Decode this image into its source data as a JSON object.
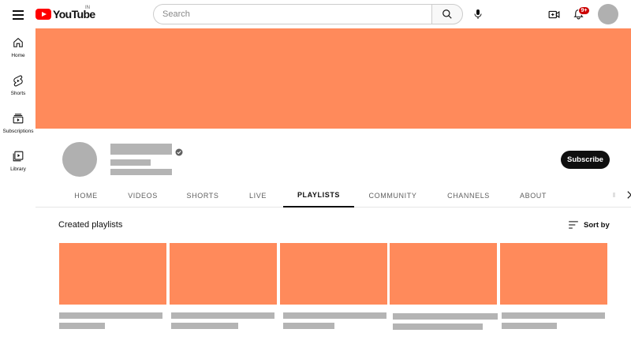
{
  "header": {
    "logo_text": "YouTube",
    "region_code": "IN",
    "search_placeholder": "Search",
    "notification_count": "9+"
  },
  "sidebar": {
    "items": [
      {
        "label": "Home",
        "icon": "home-icon"
      },
      {
        "label": "Shorts",
        "icon": "shorts-icon"
      },
      {
        "label": "Subscriptions",
        "icon": "subscriptions-icon"
      },
      {
        "label": "Library",
        "icon": "library-icon"
      }
    ]
  },
  "channel": {
    "subscribe_label": "Subscribe",
    "verified": true
  },
  "tabs": [
    {
      "label": "HOME",
      "active": false
    },
    {
      "label": "VIDEOS",
      "active": false
    },
    {
      "label": "SHORTS",
      "active": false
    },
    {
      "label": "LIVE",
      "active": false
    },
    {
      "label": "PLAYLISTS",
      "active": true
    },
    {
      "label": "COMMUNITY",
      "active": false
    },
    {
      "label": "CHANNELS",
      "active": false
    },
    {
      "label": "ABOUT",
      "active": false
    }
  ],
  "playlists": {
    "section_title": "Created playlists",
    "sort_label": "Sort by",
    "count": 5
  },
  "colors": {
    "banner": "#ff8a5b",
    "thumbnail": "#ff8a5b",
    "placeholder": "#b4b4b4",
    "brand_red": "#ff0000",
    "badge_red": "#cc0000"
  }
}
